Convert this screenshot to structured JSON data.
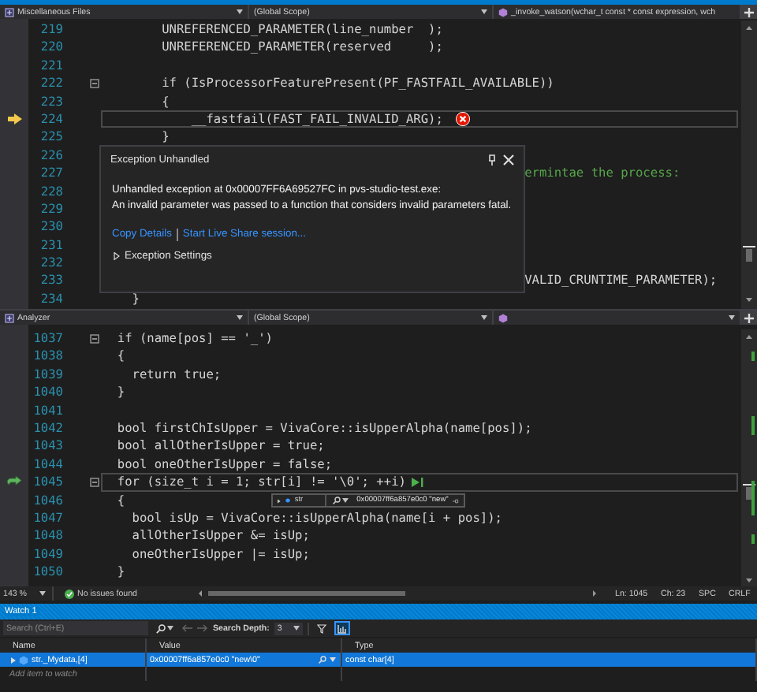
{
  "editors": [
    {
      "nav": {
        "file": "Miscellaneous Files",
        "scope": "(Global Scope)",
        "member": "_invoke_watson(wchar_t const * const expression, wch"
      },
      "lines": [
        {
          "n": "219",
          "code": "        UNREFERENCED_PARAMETER(line_number  );"
        },
        {
          "n": "220",
          "code": "        UNREFERENCED_PARAMETER(reserved     );"
        },
        {
          "n": "221"
        },
        {
          "n": "222",
          "foldable": true,
          "code": "        if (IsProcessorFeaturePresent(PF_FASTFAIL_AVAILABLE))"
        },
        {
          "n": "223",
          "code": "        {"
        },
        {
          "n": "224",
          "current_statement": true,
          "error": true,
          "code": "            __fastfail(FAST_FAIL_INVALID_ARG);"
        },
        {
          "n": "225",
          "code": "        }"
        },
        {
          "n": "226"
        },
        {
          "n": "227",
          "comment": true,
          "code": "                                                         ermintae the process:"
        },
        {
          "n": "228"
        },
        {
          "n": "229"
        },
        {
          "n": "230"
        },
        {
          "n": "231"
        },
        {
          "n": "232"
        },
        {
          "n": "233",
          "code": "                                                         VALID_CRUNTIME_PARAMETER);"
        },
        {
          "n": "234",
          "code": "    }"
        }
      ]
    },
    {
      "nav": {
        "file": "Analyzer",
        "scope": "(Global Scope)"
      },
      "lines": [
        {
          "n": "1037",
          "foldable": true,
          "code": "  if (name[pos] == '_')"
        },
        {
          "n": "1038",
          "code": "  {"
        },
        {
          "n": "1039",
          "code": "    return true;"
        },
        {
          "n": "1040",
          "code": "  }"
        },
        {
          "n": "1041"
        },
        {
          "n": "1042",
          "code": "  bool firstChIsUpper = VivaCore::isUpperAlpha(name[pos]);"
        },
        {
          "n": "1043",
          "code": "  bool allOtherIsUpper = true;"
        },
        {
          "n": "1044",
          "code": "  bool oneOtherIsUpper = false;"
        },
        {
          "n": "1045",
          "call_frame": true,
          "foldable": true,
          "run_to_click": true,
          "code": "  for (size_t i = 1; str[i] != '\\0'; ++i)"
        },
        {
          "n": "1046",
          "code": "  {"
        },
        {
          "n": "1047",
          "code": "    bool isUp = VivaCore::isUpperAlpha(name[i + pos]);"
        },
        {
          "n": "1048",
          "code": "    allOtherIsUpper &= isUp;"
        },
        {
          "n": "1049",
          "code": "    oneOtherIsUpper |= isUp;"
        },
        {
          "n": "1050",
          "code": "  }"
        }
      ]
    }
  ],
  "exception": {
    "title": "Exception Unhandled",
    "message": "Unhandled exception at 0x00007FF6A69527FC in pvs-studio-test.exe:\nAn invalid parameter was passed to a function that considers invalid parameters fatal.",
    "links": [
      "Copy Details",
      "Start Live Share session..."
    ],
    "settings": {
      "label": "Exception Settings",
      "expanded": false
    }
  },
  "datatip": {
    "name": "str",
    "value": "0x00007ff6a857e0c0 \"new\""
  },
  "status_bar": {
    "zoom": "143 %",
    "issues": "No issues found",
    "line": "Ln: 1045",
    "column": "Ch: 23",
    "whitespace": "SPC",
    "line_ending": "CRLF"
  },
  "watch": {
    "title": "Watch 1",
    "search": {
      "placeholder": "Search (Ctrl+E)"
    },
    "depth_label": "Search Depth:",
    "depth": "3",
    "columns_toggle_on": true,
    "columns": [
      "Name",
      "Value",
      "Type"
    ],
    "rows": [
      {
        "name": "str._Mydata,[4]",
        "value": "0x00007ff6a857e0c0 \"new\\0\"",
        "type": "const char[4]",
        "selected": true
      }
    ],
    "add_item": "Add item to watch"
  }
}
